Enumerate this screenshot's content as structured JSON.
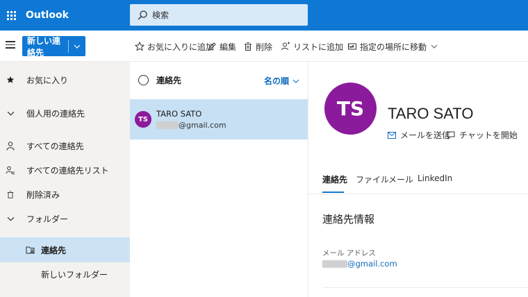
{
  "app": {
    "name": "Outlook"
  },
  "search": {
    "placeholder": "検索"
  },
  "toolbar": {
    "new_label": "新しい連絡先",
    "favorite_label": "お気に入りに追加",
    "edit_label": "編集",
    "delete_label": "削除",
    "add_to_list_label": "リストに追加",
    "move_to_label": "指定の場所に移動"
  },
  "sidebar": {
    "items": [
      {
        "label": "お気に入り",
        "icon": "star-icon"
      },
      {
        "label": "個人用の連絡先",
        "icon": "chevron-down-icon"
      },
      {
        "label": "すべての連絡先",
        "icon": "person-icon"
      },
      {
        "label": "すべての連絡先リスト",
        "icon": "people-list-icon"
      },
      {
        "label": "削除済み",
        "icon": "trash-icon"
      },
      {
        "label": "フォルダー",
        "icon": "chevron-down-icon"
      },
      {
        "label": "連絡先",
        "icon": "contact-folder-icon",
        "selected": true
      },
      {
        "label": "新しいフォルダー"
      }
    ]
  },
  "list": {
    "header": "連絡先",
    "sort_label": "名の順",
    "contacts": [
      {
        "initials": "TS",
        "name": "TARO SATO",
        "email_suffix": "@gmail.com"
      }
    ]
  },
  "detail": {
    "initials": "TS",
    "name": "TARO SATO",
    "send_mail_label": "メールを送信",
    "chat_label": "チャットを開始",
    "tabs": [
      "連絡先",
      "ファイル",
      "メール",
      "LinkedIn"
    ],
    "section_title": "連絡先情報",
    "email_label": "メール アドレス",
    "email_suffix": "@gmail.com"
  },
  "colors": {
    "brand": "#0f78d4",
    "avatar": "#8c1a9c",
    "selected_row": "#c7e0f4",
    "link": "#0f6cbd"
  }
}
